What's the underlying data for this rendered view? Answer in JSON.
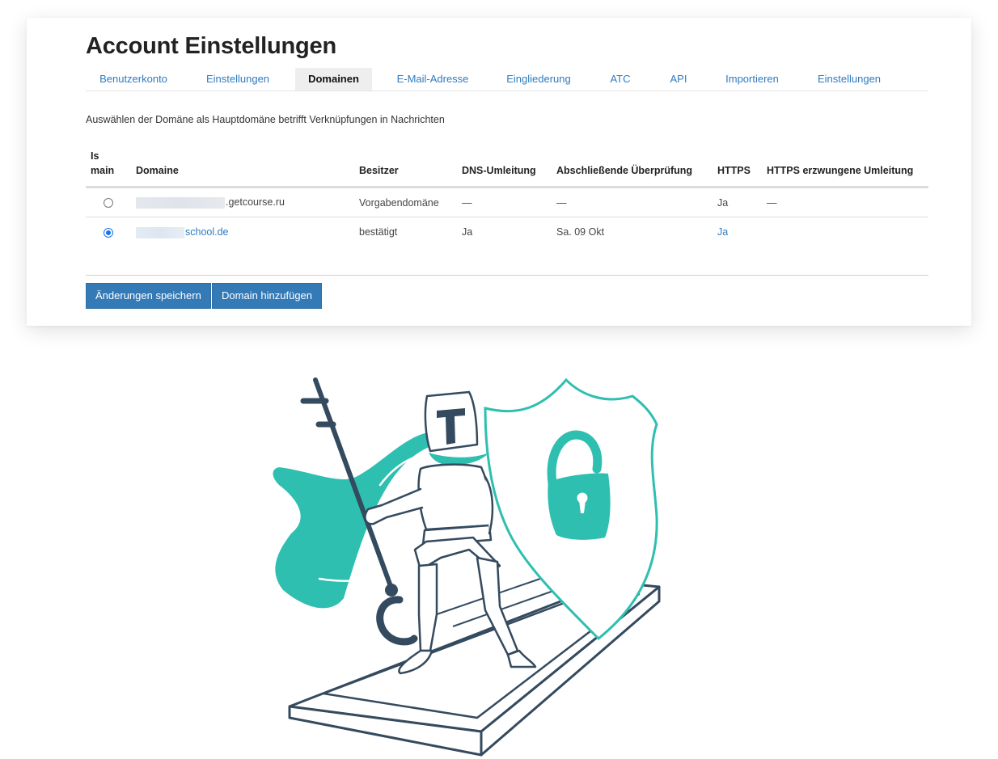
{
  "header": {
    "title": "Account Einstellungen"
  },
  "tabs": [
    {
      "label": "Benutzerkonto",
      "active": false
    },
    {
      "label": "Einstellungen",
      "active": false
    },
    {
      "label": "Domainen",
      "active": true
    },
    {
      "label": "E-Mail-Adresse",
      "active": false
    },
    {
      "label": "Eingliederung",
      "active": false
    },
    {
      "label": "ATC",
      "active": false
    },
    {
      "label": "API",
      "active": false
    },
    {
      "label": "Importieren",
      "active": false
    },
    {
      "label": "Einstellungen",
      "active": false
    }
  ],
  "description": "Auswählen der Domäne als Hauptdomäne betrifft Verknüpfungen in Nachrichten",
  "table": {
    "columns": {
      "is_main_1": "Is",
      "is_main_2": "main",
      "domain": "Domaine",
      "owner": "Besitzer",
      "dns": "DNS-Umleitung",
      "check": "Abschließende Überprüfung",
      "https": "HTTPS",
      "https_forced": "HTTPS erzwungene Umleitung"
    },
    "rows": [
      {
        "selected": false,
        "domain_suffix": ".getcourse.ru",
        "owner": "Vorgabendomäne",
        "dns": "—",
        "check": "—",
        "https": "Ja",
        "https_forced": "—"
      },
      {
        "selected": true,
        "domain_suffix": "school.de",
        "owner": "bestätigt",
        "dns": "Ja",
        "check": "Sa. 09 Okt",
        "https": "Ja",
        "https_forced": ""
      }
    ]
  },
  "buttons": {
    "save": "Änderungen speichern",
    "add_domain": "Domain hinzufügen"
  },
  "colors": {
    "accent": "#337ab7",
    "link": "#2f7bbf",
    "teal": "#2ebfb0",
    "navy": "#344a5e"
  }
}
